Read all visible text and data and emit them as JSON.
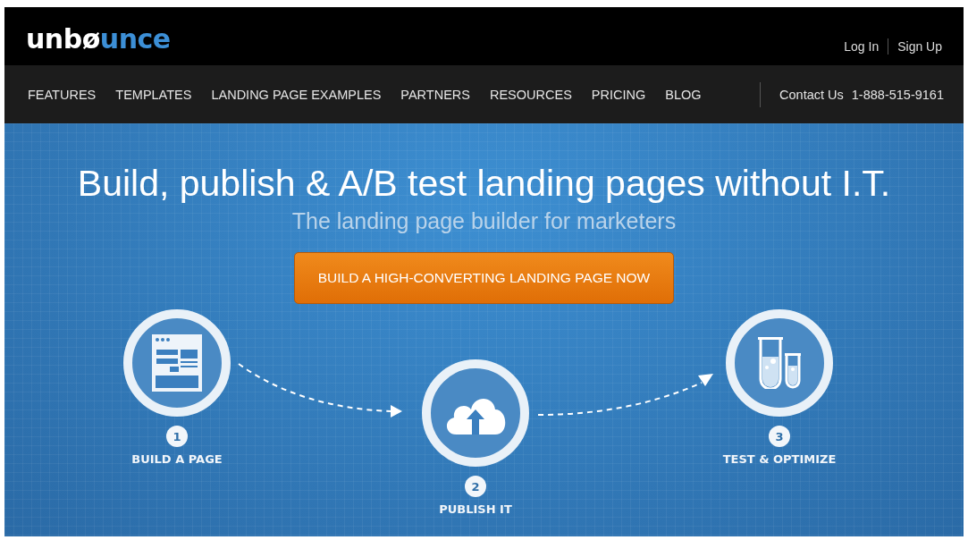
{
  "logo": {
    "light": "unbø",
    "accent": "unce"
  },
  "account_links": [
    {
      "label": "Log In"
    },
    {
      "label": "Sign Up"
    }
  ],
  "nav": [
    {
      "label": "FEATURES"
    },
    {
      "label": "TEMPLATES"
    },
    {
      "label": "LANDING PAGE EXAMPLES"
    },
    {
      "label": "PARTNERS"
    },
    {
      "label": "RESOURCES"
    },
    {
      "label": "PRICING"
    },
    {
      "label": "BLOG"
    }
  ],
  "contact": {
    "label": "Contact Us",
    "phone": "1-888-515-9161"
  },
  "hero": {
    "title": "Build, publish & A/B test landing pages without I.T.",
    "subtitle": "The landing page builder for marketers",
    "cta": "BUILD A HIGH-CONVERTING LANDING PAGE NOW"
  },
  "steps": [
    {
      "number": "1",
      "label": "BUILD A PAGE"
    },
    {
      "number": "2",
      "label": "PUBLISH IT"
    },
    {
      "number": "3",
      "label": "TEST & OPTIMIZE"
    }
  ]
}
